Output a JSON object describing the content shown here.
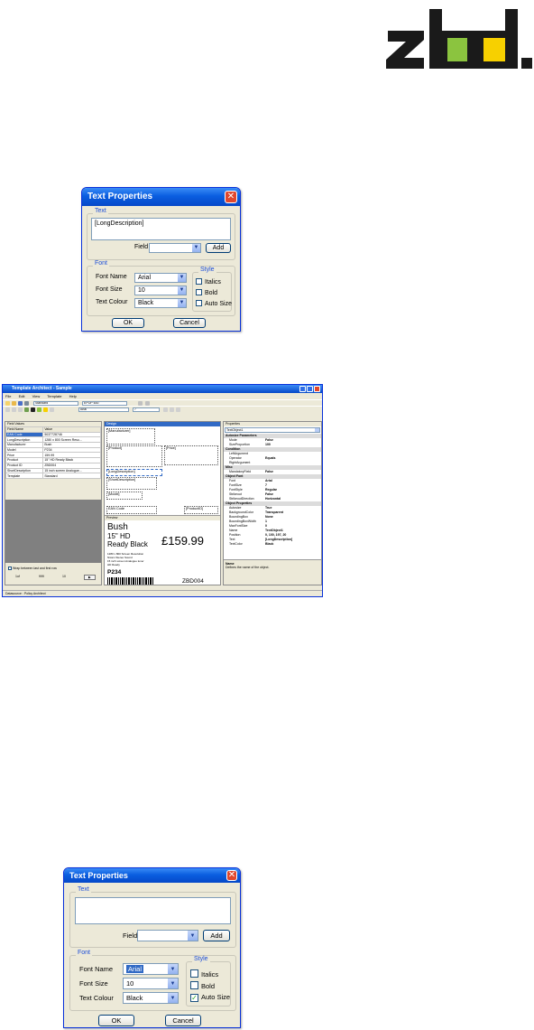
{
  "logo": {
    "text": "zbd."
  },
  "dialog1": {
    "title": "Text Properties",
    "text_group": "Text",
    "text_value": "[LongDescription]",
    "field_label": "Field",
    "field_value": "",
    "add_label": "Add",
    "font_group": "Font",
    "font_name_label": "Font Name",
    "font_name_value": "Arial",
    "font_size_label": "Font Size",
    "font_size_value": "10",
    "text_colour_label": "Text Colour",
    "text_colour_value": "Black",
    "style_group": "Style",
    "italics_label": "Italics",
    "bold_label": "Bold",
    "autosize_label": "Auto Size",
    "italics_checked": false,
    "bold_checked": false,
    "autosize_checked": false,
    "ok_label": "OK",
    "cancel_label": "Cancel"
  },
  "app": {
    "title": "Template Architect - Sample",
    "menu": [
      "File",
      "Edit",
      "View",
      "Template",
      "Help"
    ],
    "toolbar_combo1": "Standard",
    "toolbar_combo2": "EPOP 600",
    "toolbar_font": "Arial",
    "toolbar_size": "7",
    "field_values_header": "Field Values",
    "fv_col1": "Field Name",
    "fv_col2": "Value",
    "fv_rows": [
      [
        "EAN Code",
        "5037728746"
      ],
      [
        "LongDescription",
        "1280 x 800 Screen Reso..."
      ],
      [
        "Manufacturer",
        "Bush"
      ],
      [
        "Model",
        "P234"
      ],
      [
        "Price",
        "159.99"
      ],
      [
        "Product",
        "15\" HD Ready Black"
      ],
      [
        "Product ID",
        "ZBD004"
      ],
      [
        "ShortDescription",
        "15 inch screen Analogue..."
      ],
      [
        "Template",
        "Standard"
      ]
    ],
    "wrap_label": "Wrap between last and first row",
    "fv_nav": [
      "1of",
      "999",
      "10",
      "▶"
    ],
    "design_header": "Design",
    "design_fields": {
      "manufacturer": "[Manufacturer]",
      "product": "[Product]",
      "price": "[Price]",
      "longdesc": "[LongDescription]",
      "shortdesc": "[ShortDescription]",
      "model": "[Model]",
      "ean": "EAN Code",
      "productid": "[ProductID]"
    },
    "preview_header": "Preview",
    "preview": {
      "brand": "Bush",
      "line2": "15\" HD",
      "line3": "Ready Black",
      "price": "£159.99",
      "desc1": "1280 x 800 Screen Resolution",
      "desc2": "Nicam Stereo Sound",
      "desc3": "15 inch screen Analogue tuner",
      "desc4": "HD Ready",
      "model": "P234",
      "productid": "ZBD004"
    },
    "properties_header": "Properties",
    "properties_object": "TextObject1",
    "props": [
      {
        "cat": true,
        "k": "Autosize Parameters"
      },
      {
        "k": "Mode",
        "v": "False"
      },
      {
        "k": "SizeProportion",
        "v": "100"
      },
      {
        "cat": true,
        "k": "Condition"
      },
      {
        "k": "LeftArgument",
        "v": ""
      },
      {
        "k": "Operator",
        "v": "Equals"
      },
      {
        "k": "RightArgument",
        "v": ""
      },
      {
        "cat": true,
        "k": "Misc"
      },
      {
        "k": "MandatoryField",
        "v": "False"
      },
      {
        "cat": true,
        "k": "Object Font"
      },
      {
        "k": "Font",
        "v": "Arial"
      },
      {
        "k": "FontSize",
        "v": "7"
      },
      {
        "k": "FontStyle",
        "v": "Regular"
      },
      {
        "k": "Strikeout",
        "v": "False"
      },
      {
        "k": "StrikeoutDirection",
        "v": "Horizontal"
      },
      {
        "cat": true,
        "k": "Object Properties"
      },
      {
        "k": "Autosize",
        "v": "True"
      },
      {
        "k": "BackgroundColor",
        "v": "Transparent"
      },
      {
        "k": "BoundingBox",
        "v": "None"
      },
      {
        "k": "BoundingBoxWidth",
        "v": "1"
      },
      {
        "k": "MaxFontSize",
        "v": "0"
      },
      {
        "k": "Name",
        "v": "TextObject1"
      },
      {
        "k": "Position",
        "v": "0, 100, 197, 20"
      },
      {
        "k": "Text",
        "v": "[LongDescription]"
      },
      {
        "k": "TextColor",
        "v": "Black"
      }
    ],
    "prop_desc_title": "Name",
    "prop_desc_text": "Defines the name of the object.",
    "status": "Datasource : Policy Architect"
  },
  "dialog2": {
    "title": "Text Properties",
    "text_group": "Text",
    "text_value": "",
    "field_label": "Field",
    "field_value": "",
    "add_label": "Add",
    "font_group": "Font",
    "font_name_label": "Font Name",
    "font_name_value": "Arial",
    "font_size_label": "Font Size",
    "font_size_value": "10",
    "text_colour_label": "Text Colour",
    "text_colour_value": "Black",
    "style_group": "Style",
    "italics_label": "Italics",
    "bold_label": "Bold",
    "autosize_label": "Auto Size",
    "italics_checked": false,
    "bold_checked": false,
    "autosize_checked": true,
    "ok_label": "OK",
    "cancel_label": "Cancel"
  },
  "colors": {
    "accent": "#0a5ee0",
    "selection": "#316ac5",
    "dialog_bg": "#ece9d8",
    "logo_green": "#8bc43f",
    "logo_yellow": "#f7d000"
  }
}
